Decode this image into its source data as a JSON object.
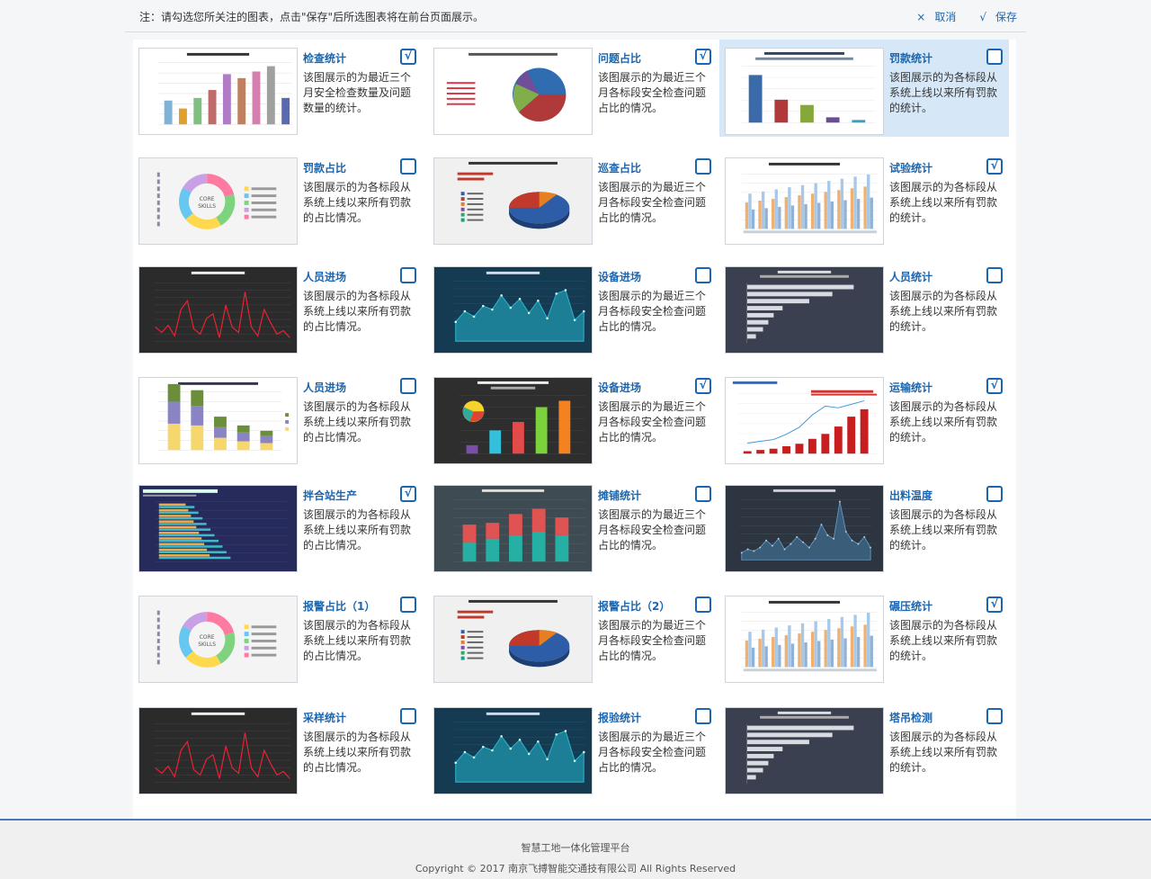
{
  "notice": "注：请勾选您所关注的图表，点击\"保存\"后所选图表将在前台页面展示。",
  "actions": {
    "cancel_icon": "×",
    "cancel_label": "取消",
    "save_icon": "√",
    "save_label": "保存"
  },
  "check_mark": "√",
  "cards": [
    {
      "title": "检查统计",
      "desc": "该图展示的为最近三个月安全检查数量及问题数量的统计。",
      "checked": true,
      "selected": false,
      "thumb": "bars-light",
      "thumb_title": "Hello World's Height In Alphabet"
    },
    {
      "title": "问题占比",
      "desc": "该图展示的为最近三个月各标段安全检查问题占比的情况。",
      "checked": true,
      "selected": false,
      "thumb": "pie-light",
      "thumb_title": "2013年度中国第三方手机浏览器市场份额"
    },
    {
      "title": "罚款统计",
      "desc": "该图展示的为各标段从系统上线以来所有罚款的统计。",
      "checked": false,
      "selected": true,
      "thumb": "bars-column",
      "thumb_title": "This is a sample spic8 from HighCharts"
    },
    {
      "title": "罚款占比",
      "desc": "该图展示的为各标段从系统上线以来所有罚款的占比情况。",
      "checked": false,
      "selected": false,
      "thumb": "donut",
      "thumb_title": "CORE SKILLS"
    },
    {
      "title": "巡查占比",
      "desc": "该图展示的为最近三个月各标段安全检查问题占比的情况。",
      "checked": false,
      "selected": false,
      "thumb": "pie3d",
      "thumb_title": "Mobile-Friendly Distribution"
    },
    {
      "title": "试验统计",
      "desc": "该图展示的为各标段从系统上线以来所有罚款的统计。",
      "checked": true,
      "selected": false,
      "thumb": "grouped",
      "thumb_title": "2002-2011年全国客运人数"
    },
    {
      "title": "人员进场",
      "desc": "该图展示的为各标段从系统上线以来所有罚款的占比情况。",
      "checked": false,
      "selected": false,
      "thumb": "line-dark",
      "thumb_title": "ichartjs官方网站上一日PV流量"
    },
    {
      "title": "设备进场",
      "desc": "该图展示的为最近三个月各标段安全检查问题占比的情况。",
      "checked": false,
      "selected": false,
      "thumb": "area-teal",
      "thumb_title": "A产品2011年第二季度趋势"
    },
    {
      "title": "人员统计",
      "desc": "该图展示的为各标段从系统上线以来所有罚款的统计。",
      "checked": false,
      "selected": false,
      "thumb": "hbar-dark",
      "thumb_title": "StatCounter Global Stats"
    },
    {
      "title": "人员进场",
      "desc": "该图展示的为各标段从系统上线以来所有罚款的占比情况。",
      "checked": false,
      "selected": false,
      "thumb": "stacked",
      "thumb_title": "全国发电企业总量(亿度)TOP5"
    },
    {
      "title": "设备进场",
      "desc": "该图展示的为最近三个月各标段安全检查问题占比的情况。",
      "checked": true,
      "selected": false,
      "thumb": "combo-dark",
      "thumb_title": "This is a sample for Combination"
    },
    {
      "title": "运输统计",
      "desc": "该图展示的为各标段从系统上线以来所有罚款的统计。",
      "checked": true,
      "selected": false,
      "thumb": "barline",
      "thumb_title": "The Rise of Pinterest"
    },
    {
      "title": "拌合站生产",
      "desc": "该图展示的为各标段从系统上线以来所有罚款的占比情况。",
      "checked": true,
      "selected": false,
      "thumb": "hbar-navy",
      "thumb_title": "Total U.S Retail Software Revenue"
    },
    {
      "title": "摊铺统计",
      "desc": "该图展示的为最近三个月各标段安全检查问题占比的情况。",
      "checked": false,
      "selected": false,
      "thumb": "stack-gray",
      "thumb_title": "全国网络口上次保存数据情况"
    },
    {
      "title": "出料温度",
      "desc": "该图展示的为各标段从系统上线以来所有罚款的统计。",
      "checked": false,
      "selected": false,
      "thumb": "area-dark",
      "thumb_title": "2013年重庆某地产品A销售情况"
    },
    {
      "title": "报警占比（1）",
      "desc": "该图展示的为各标段从系统上线以来所有罚款的占比情况。",
      "checked": false,
      "selected": false,
      "thumb": "donut",
      "thumb_title": "CORE SKILLS"
    },
    {
      "title": "报警占比（2）",
      "desc": "该图展示的为最近三个月各标段安全检查问题占比的情况。",
      "checked": false,
      "selected": false,
      "thumb": "pie3d",
      "thumb_title": "Mobile-Friendly Distribution"
    },
    {
      "title": "碾压统计",
      "desc": "该图展示的为各标段从系统上线以来所有罚款的统计。",
      "checked": true,
      "selected": false,
      "thumb": "grouped",
      "thumb_title": "2002-2011年全国客运人数"
    },
    {
      "title": "采样统计",
      "desc": "该图展示的为各标段从系统上线以来所有罚款的占比情况。",
      "checked": false,
      "selected": false,
      "thumb": "line-dark",
      "thumb_title": "ichartjs官方网站上一日PV流量"
    },
    {
      "title": "报验统计",
      "desc": "该图展示的为最近三个月各标段安全检查问题占比的情况。",
      "checked": false,
      "selected": false,
      "thumb": "area-teal",
      "thumb_title": "A产品2011年第二季度趋势"
    },
    {
      "title": "塔吊检测",
      "desc": "该图展示的为各标段从系统上线以来所有罚款的统计。",
      "checked": false,
      "selected": false,
      "thumb": "hbar-dark",
      "thumb_title": "StatCounter Global Stats"
    }
  ],
  "footer": {
    "platform": "智慧工地一体化管理平台",
    "copyright": "Copyright © 2017 南京飞搏智能交通技有限公司 All Rights Reserved"
  }
}
